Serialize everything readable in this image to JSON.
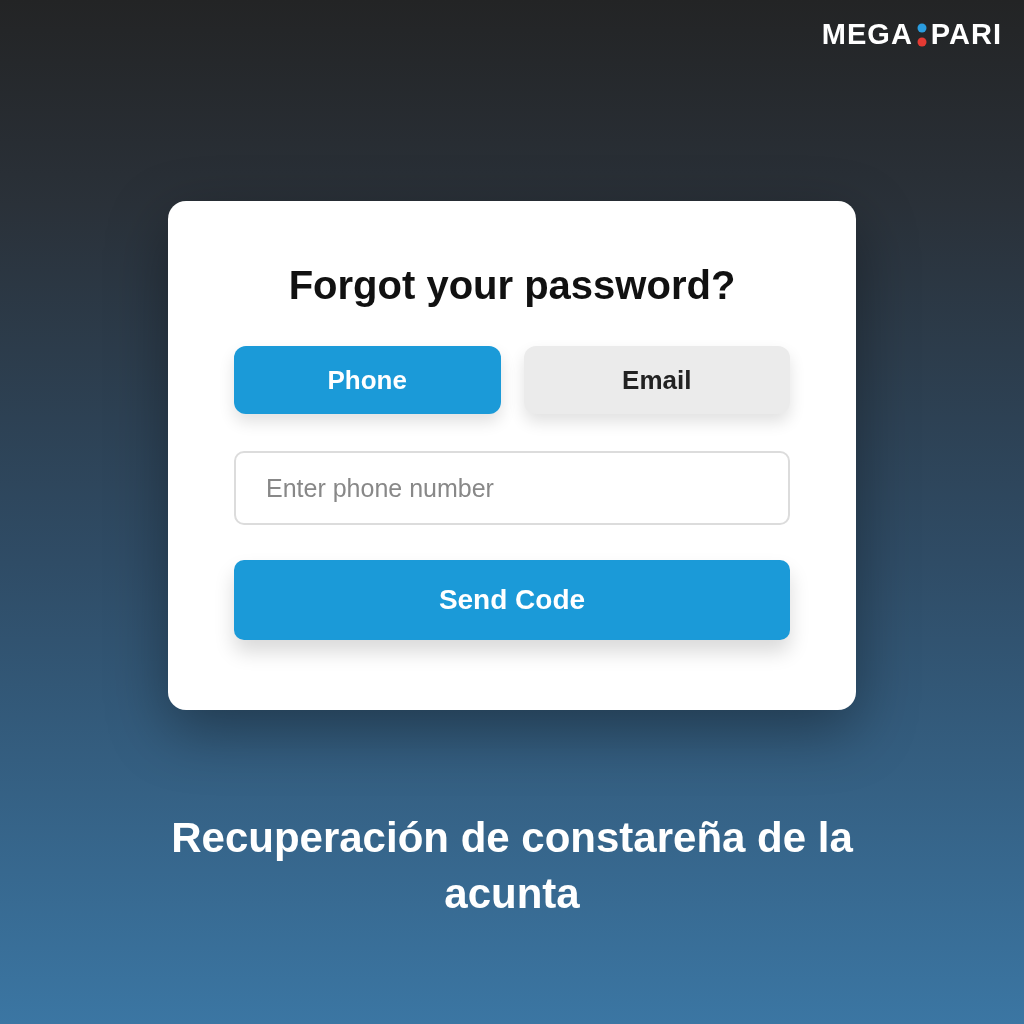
{
  "logo": {
    "left": "MEGA",
    "right": "PARI"
  },
  "card": {
    "title": "Forgot your password?",
    "tabs": [
      {
        "label": "Phone",
        "selected": true
      },
      {
        "label": "Email",
        "selected": false
      }
    ],
    "field": {
      "placeholder": "Enter phone number"
    },
    "button": "Send Code"
  },
  "caption": "Recuperación de constareña de la acunta"
}
